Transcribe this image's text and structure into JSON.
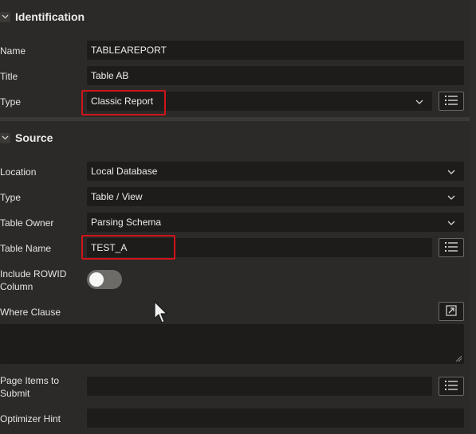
{
  "identification": {
    "title": "Identification",
    "name": {
      "label": "Name",
      "value": "TABLEAREPORT"
    },
    "title_field": {
      "label": "Title",
      "value": "Table AB"
    },
    "type": {
      "label": "Type",
      "value": "Classic Report"
    }
  },
  "source": {
    "title": "Source",
    "location": {
      "label": "Location",
      "value": "Local Database"
    },
    "type": {
      "label": "Type",
      "value": "Table / View"
    },
    "table_owner": {
      "label": "Table Owner",
      "value": "Parsing Schema"
    },
    "table_name": {
      "label": "Table Name",
      "value": "TEST_A"
    },
    "include_rowid": {
      "label_line1": "Include ROWID",
      "label_line2": "Column",
      "value": false
    },
    "where_clause": {
      "label": "Where Clause",
      "value": ""
    },
    "page_items": {
      "label_line1": "Page Items to",
      "label_line2": "Submit",
      "value": ""
    },
    "optimizer_hint": {
      "label": "Optimizer Hint",
      "value": ""
    }
  },
  "colors": {
    "background": "#2b2a28",
    "field": "#1d1c1b",
    "highlight": "#d0141a"
  },
  "icons": [
    "chevron-down-icon",
    "list-icon",
    "expand-icon",
    "mouse-pointer-icon"
  ]
}
